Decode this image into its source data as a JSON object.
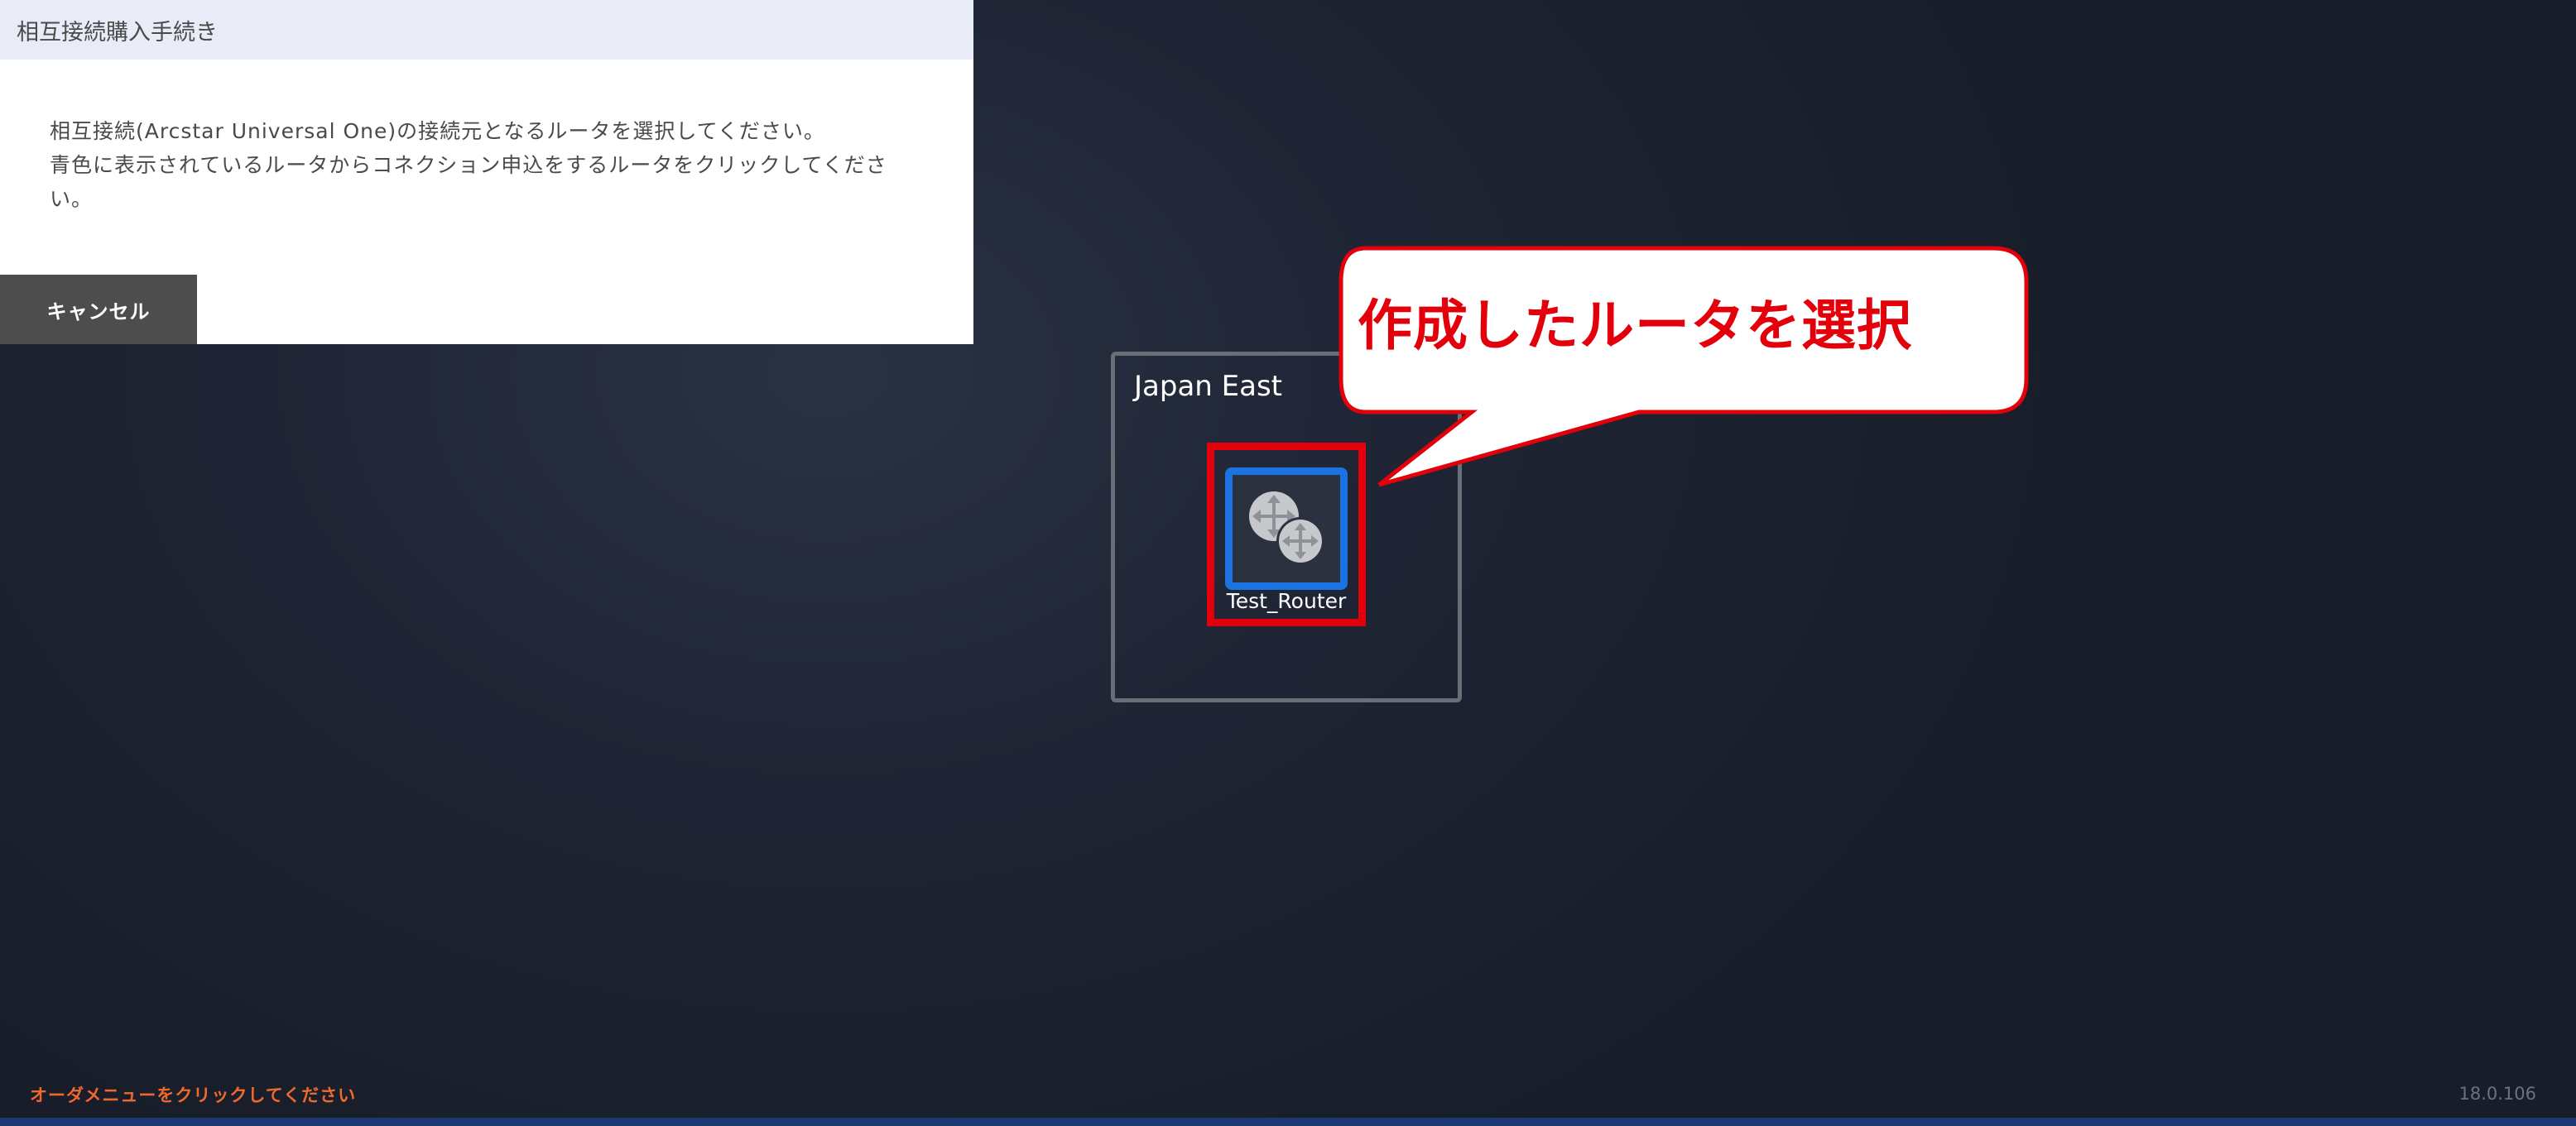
{
  "dialog": {
    "title": "相互接続購入手続き",
    "line1": "相互接続(Arcstar Universal One)の接続元となるルータを選択してください。",
    "line2": "青色に表示されているルータからコネクション申込をするルータをクリックしてください。",
    "cancel_label": "キャンセル"
  },
  "region": {
    "label": "Japan East"
  },
  "router": {
    "name": "Test_Router",
    "icon": "router-icon",
    "border_color": "#1a73e0"
  },
  "callout": {
    "text": "作成したルータを選択",
    "color": "#e3000b"
  },
  "footer": {
    "hint": "オーダメニューをクリックしてください",
    "version": "18.0.106"
  }
}
